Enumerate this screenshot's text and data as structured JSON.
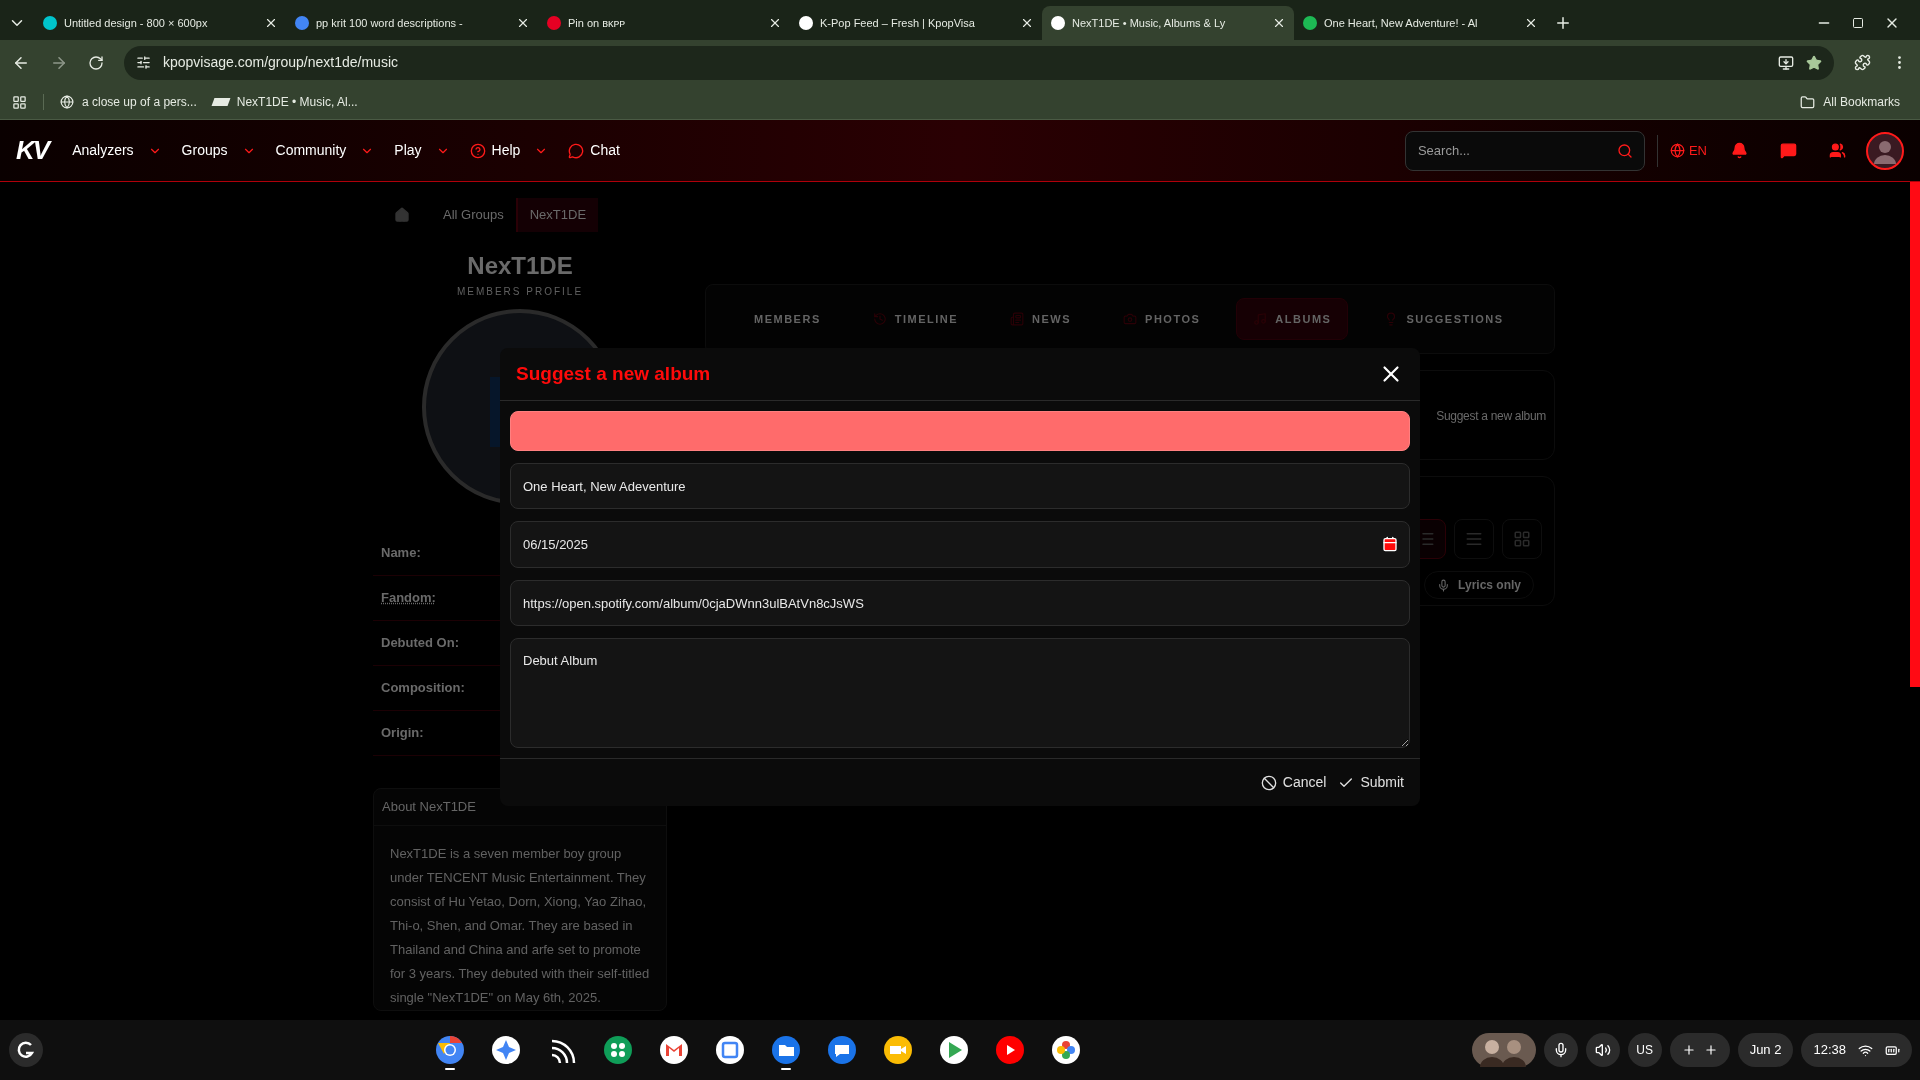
{
  "browser": {
    "tabs": [
      {
        "title": "Untitled design - 800 × 600px",
        "selected": false
      },
      {
        "title": "pp krit 100 word descriptions -",
        "selected": false
      },
      {
        "title": "Pin on ʙᴋᴘᴘ",
        "selected": false
      },
      {
        "title": "K-Pop Feed – Fresh | KpopVisa",
        "selected": false
      },
      {
        "title": "NexT1DE • Music, Albums & Ly",
        "selected": true
      },
      {
        "title": "One Heart, New Adventure! - Al",
        "selected": false
      }
    ],
    "address": "kpopvisage.com/group/next1de/music",
    "bookmarks": [
      "a close up of a pers...",
      "NexT1DE • Music, Al..."
    ],
    "all_bookmarks": "All Bookmarks"
  },
  "site_nav": {
    "logo": "KV",
    "items": [
      {
        "label": "Analyzers",
        "kind": "menu"
      },
      {
        "label": "Groups",
        "kind": "menu"
      },
      {
        "label": "Community",
        "kind": "menu"
      },
      {
        "label": "Play",
        "kind": "menu"
      },
      {
        "label": "Help",
        "kind": "help"
      },
      {
        "label": "Chat",
        "kind": "chat"
      }
    ],
    "search_placeholder": "Search...",
    "language": "EN"
  },
  "breadcrumb": [
    {
      "label": "All Groups",
      "selected": false
    },
    {
      "label": "NexT1DE",
      "selected": true
    }
  ],
  "group": {
    "name": "NexT1DE",
    "subtitle": "MEMBERS PROFILE",
    "fields": [
      "Name:",
      "Fandom:",
      "Debuted On:",
      "Composition:",
      "Origin:"
    ],
    "about_title": "About NexT1DE",
    "about_text": "NexT1DE is a seven member boy group under TENCENT Music Entertainment. They consist of Hu Yetao, Dorn, Xiong, Yao Zihao, Thi-o, Shen, and Omar. They are based in Thailand and China and arfe set to promote for 3 years. They debuted with their self-titled single \"NexT1DE\" on May 6th, 2025."
  },
  "profile_tabs": [
    {
      "label": "MEMBERS",
      "selected": false
    },
    {
      "label": "TIMELINE",
      "selected": false
    },
    {
      "label": "NEWS",
      "selected": false
    },
    {
      "label": "PHOTOS",
      "selected": false
    },
    {
      "label": "ALBUMS",
      "selected": true
    },
    {
      "label": "SUGGESTIONS",
      "selected": false
    }
  ],
  "suggest_link": "Suggest a new album",
  "views": [
    {
      "kind": "list",
      "selected": true
    },
    {
      "kind": "lines",
      "selected": false
    },
    {
      "kind": "grid",
      "selected": false
    }
  ],
  "lyrics_only": "Lyrics only",
  "modal": {
    "title": "Suggest a new album",
    "fields": [
      {
        "kind": "error"
      },
      {
        "kind": "text",
        "value": "One Heart, New Adeventure"
      },
      {
        "kind": "date",
        "value": "06/15/2025"
      },
      {
        "kind": "text",
        "value": "https://open.spotify.com/album/0cjaDWnn3ulBAtVn8cJsWS"
      },
      {
        "kind": "textarea",
        "value": "Debut Album"
      }
    ],
    "buttons": [
      {
        "label": "Cancel",
        "kind": "cancel"
      },
      {
        "label": "Submit",
        "kind": "submit"
      }
    ]
  },
  "taskbar": {
    "apps": [
      {
        "running": true
      },
      {
        "running": false
      },
      {
        "running": false
      },
      {
        "running": false
      },
      {
        "running": false
      },
      {
        "running": false
      },
      {
        "running": true
      },
      {
        "running": false
      },
      {
        "running": false
      },
      {
        "running": false
      },
      {
        "running": false
      },
      {
        "running": false
      }
    ],
    "keyboard": "US",
    "date": "Jun 2",
    "time": "12:38"
  }
}
